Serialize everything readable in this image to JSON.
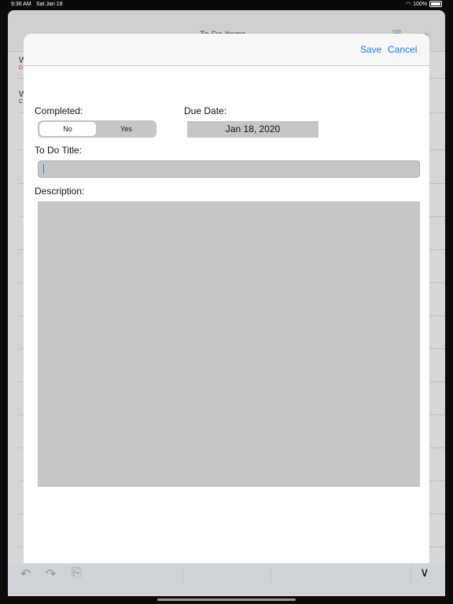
{
  "status_bar": {
    "time": "9:36 AM",
    "date": "Sat Jan 18",
    "battery": "100%"
  },
  "background_app": {
    "title": "To Do Items",
    "rows": [
      {
        "title": "W",
        "sub": "D"
      },
      {
        "title": "W",
        "sub": "C"
      }
    ]
  },
  "modal": {
    "save_label": "Save",
    "cancel_label": "Cancel",
    "completed_label": "Completed:",
    "completed_options": [
      "No",
      "Yes"
    ],
    "completed_selected": "No",
    "due_date_label": "Due Date:",
    "due_date_value": "Jan 18, 2020",
    "title_label": "To Do Title:",
    "title_value": "",
    "description_label": "Description:",
    "description_value": ""
  },
  "icons": {
    "undo": "undo-icon",
    "redo": "redo-icon",
    "paste": "paste-icon",
    "hide_keyboard": "chevron-down-icon"
  },
  "colors": {
    "accent": "#1e7cf2",
    "field_bg": "#c6c6c9"
  }
}
